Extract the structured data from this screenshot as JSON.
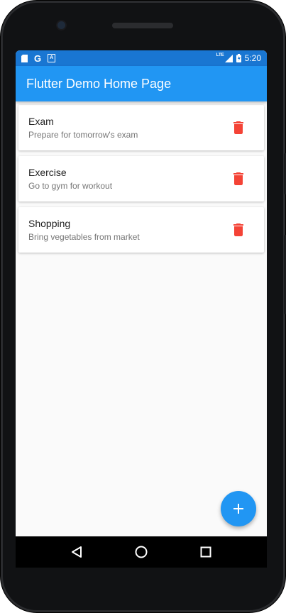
{
  "status_bar": {
    "time": "5:20",
    "network": "LTE",
    "left_icons": [
      "sd-card-icon",
      "google-g-icon",
      "a-notification-icon"
    ],
    "right_icons": [
      "signal-icon",
      "battery-icon"
    ]
  },
  "app_bar": {
    "title": "Flutter Demo Home Page"
  },
  "todos": [
    {
      "title": "Exam",
      "subtitle": "Prepare for tomorrow's exam"
    },
    {
      "title": "Exercise",
      "subtitle": "Go to gym for workout"
    },
    {
      "title": "Shopping",
      "subtitle": "Bring vegetables from market"
    }
  ],
  "icons": {
    "delete": "delete-icon",
    "fab": "add-icon",
    "nav": [
      "back-icon",
      "home-icon",
      "recents-icon"
    ],
    "g_letter": "G",
    "a_letter": "A"
  },
  "colors": {
    "primary": "#2196f3",
    "status_bar": "#1976d2",
    "delete": "#f44336",
    "background": "#fafafa"
  }
}
